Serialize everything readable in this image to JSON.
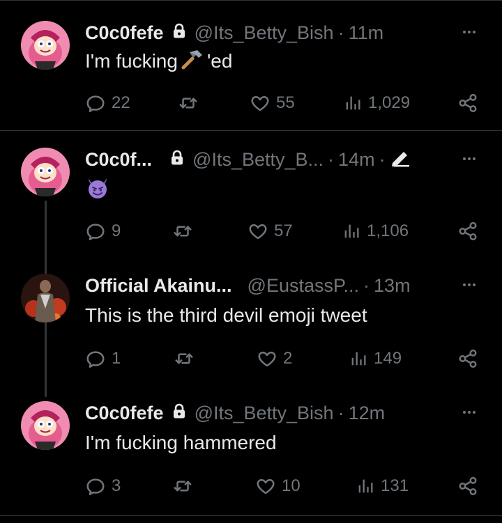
{
  "tweets": [
    {
      "name": "C0c0fefe",
      "handle": "@Its_Betty_Bish",
      "sep": "·",
      "time": "11m",
      "text_before": "I'm fucking ",
      "text_after": "'ed",
      "replies": "22",
      "retweets": "",
      "likes": "55",
      "views": "1,029"
    },
    {
      "name": "C0c0f...",
      "handle": "@Its_Betty_B...",
      "sep": "·",
      "time": "14m",
      "sep2": "·",
      "text": "",
      "replies": "9",
      "retweets": "",
      "likes": "57",
      "views": "1,106"
    },
    {
      "name": "Official Akainu...",
      "handle": "@EustassP...",
      "sep": "·",
      "time": "13m",
      "text": "This is the third devil emoji tweet",
      "replies": "1",
      "retweets": "",
      "likes": "2",
      "views": "149"
    },
    {
      "name": "C0c0fefe",
      "handle": "@Its_Betty_Bish",
      "sep": "·",
      "time": "12m",
      "text": "I'm fucking hammered",
      "replies": "3",
      "retweets": "",
      "likes": "10",
      "views": "131"
    }
  ],
  "icons": {
    "reply": "reply-icon",
    "retweet": "retweet-icon",
    "like": "heart-icon",
    "views": "views-icon",
    "share": "share-icon",
    "more": "more-icon",
    "lock": "lock-icon",
    "hammer": "hammer-emoji",
    "devil": "smiling-devil-emoji",
    "edit": "pencil-edit-icon"
  },
  "colors": {
    "background": "#000000",
    "text": "#e7e9ea",
    "muted": "#71767b",
    "divider": "#2f3336"
  }
}
